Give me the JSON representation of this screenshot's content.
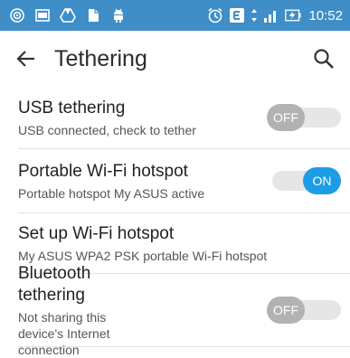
{
  "status_bar": {
    "time": "10:52",
    "left_icons": [
      "hotspot-icon",
      "gallery-icon",
      "drive-icon",
      "file-icon",
      "android-icon"
    ],
    "right_icons": [
      "alarm-icon",
      "data-e-icon",
      "data-arrows-icon",
      "signal-icon",
      "battery-charging-icon"
    ],
    "background": "#3f8ec8"
  },
  "app_bar": {
    "title": "Tethering"
  },
  "items": [
    {
      "title": "USB tethering",
      "subtitle": "USB connected, check to tether",
      "toggle": "OFF"
    },
    {
      "title": "Portable Wi-Fi hotspot",
      "subtitle": "Portable hotspot My ASUS active",
      "toggle": "ON"
    },
    {
      "title": "Set up Wi-Fi hotspot",
      "subtitle": "My ASUS WPA2 PSK portable Wi-Fi hotspot"
    },
    {
      "title": "Bluetooth tethering",
      "subtitle": "Not sharing this device's Internet connection",
      "toggle": "OFF"
    }
  ],
  "colors": {
    "accent_on": "#1e9ce6",
    "toggle_off": "#b2b2b2"
  }
}
